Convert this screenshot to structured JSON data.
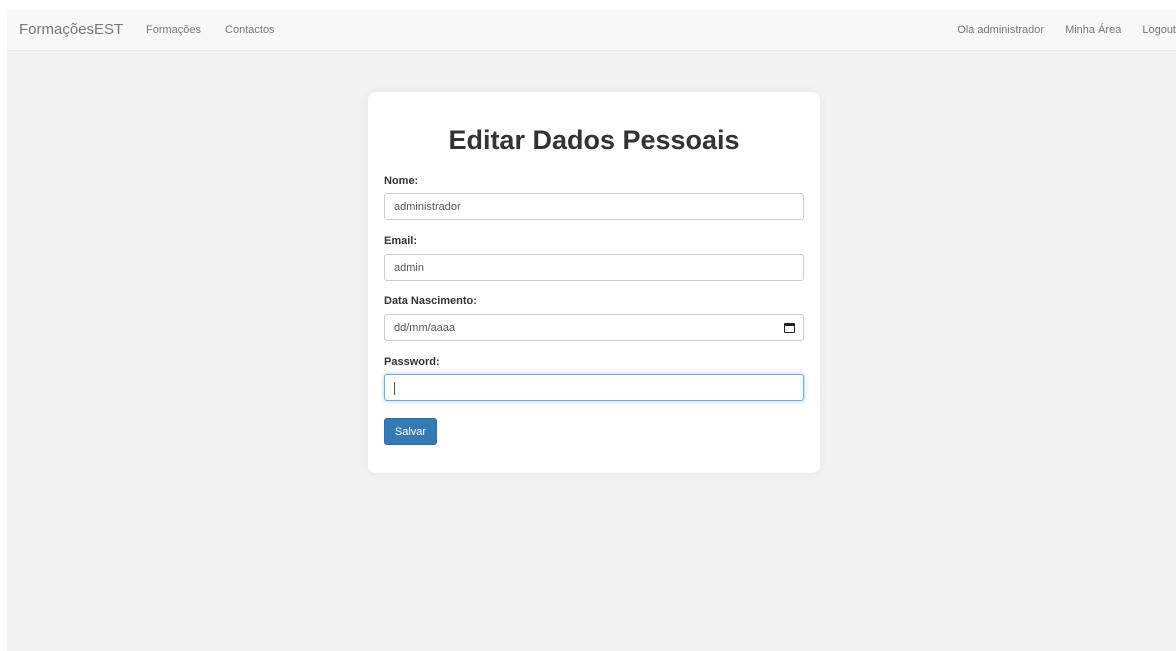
{
  "navbar": {
    "brand": "FormaçõesEST",
    "left_links": [
      "Formações",
      "Contactos"
    ],
    "greeting": "Ola administrador",
    "my_area": "Minha Área",
    "logout": "Logout"
  },
  "form": {
    "title": "Editar Dados Pessoais",
    "nome": {
      "label": "Nome:",
      "value": "administrador"
    },
    "email": {
      "label": "Email:",
      "value": "admin"
    },
    "data_nascimento": {
      "label": "Data Nascimento:",
      "placeholder": "dd/mm/aaaa",
      "icon": "calendar-icon"
    },
    "password": {
      "label": "Password:",
      "value": ""
    },
    "submit_label": "Salvar"
  },
  "colors": {
    "primary_button": "#337ab7",
    "focus_border": "#66afe9",
    "page_background": "#f2f2f2"
  }
}
